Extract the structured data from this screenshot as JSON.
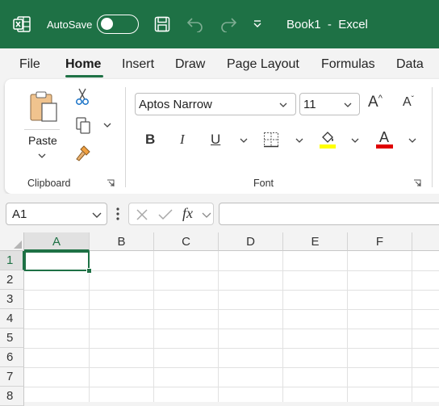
{
  "titlebar": {
    "autosave_label": "AutoSave",
    "autosave_state": "off",
    "document_title": "Book1  -  Excel"
  },
  "tabs": [
    {
      "label": "File",
      "active": false
    },
    {
      "label": "Home",
      "active": true
    },
    {
      "label": "Insert",
      "active": false
    },
    {
      "label": "Draw",
      "active": false
    },
    {
      "label": "Page Layout",
      "active": false
    },
    {
      "label": "Formulas",
      "active": false
    },
    {
      "label": "Data",
      "active": false
    }
  ],
  "ribbon": {
    "clipboard": {
      "paste_label": "Paste",
      "group_label": "Clipboard"
    },
    "font": {
      "font_name": "Aptos Narrow",
      "font_size": "11",
      "bold": "B",
      "italic": "I",
      "underline": "U",
      "grow_font": "A",
      "shrink_font": "A",
      "font_color_letter": "A",
      "highlight_color": "#ffff00",
      "font_color": "#e00000",
      "group_label": "Font"
    }
  },
  "formula_bar": {
    "name_box": "A1",
    "fx_label": "fx",
    "formula": ""
  },
  "grid": {
    "columns": [
      "A",
      "B",
      "C",
      "D",
      "E",
      "F"
    ],
    "rows": [
      "1",
      "2",
      "3",
      "4",
      "5",
      "6",
      "7",
      "8"
    ],
    "active_cell": "A1"
  },
  "colors": {
    "accent": "#1e7145"
  }
}
